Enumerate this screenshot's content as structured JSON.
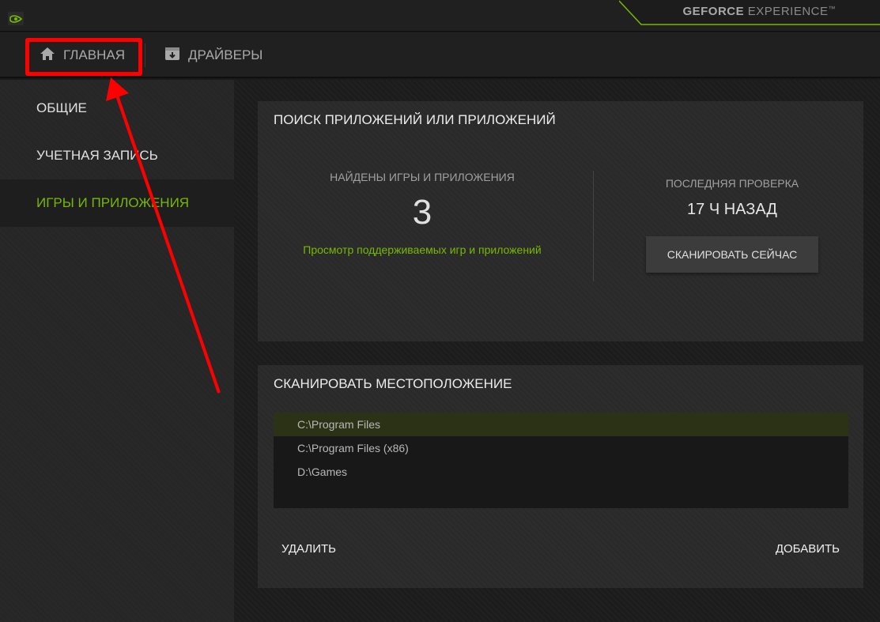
{
  "brand": {
    "bold": "GEFORCE",
    "light": "EXPERIENCE",
    "tm": "™"
  },
  "nav": {
    "home_label": "ГЛАВНАЯ",
    "drivers_label": "ДРАЙВЕРЫ"
  },
  "sidebar": {
    "items": [
      {
        "label": "ОБЩИЕ"
      },
      {
        "label": "УЧЕТНАЯ ЗАПИСЬ"
      },
      {
        "label": "ИГРЫ И ПРИЛОЖЕНИЯ"
      }
    ],
    "active_index": 2
  },
  "search_panel": {
    "title": "ПОИСК ПРИЛОЖЕНИЙ ИЛИ ПРИЛОЖЕНИЙ",
    "found_label": "НАЙДЕНЫ ИГРЫ И ПРИЛОЖЕНИЯ",
    "found_count": "3",
    "supported_link": "Просмотр поддерживаемых игр и приложений",
    "last_check_label": "ПОСЛЕДНЯЯ ПРОВЕРКА",
    "last_check_value": "17 Ч НАЗАД",
    "scan_button": "СКАНИРОВАТЬ СЕЙЧАС"
  },
  "location_panel": {
    "title": "СКАНИРОВАТЬ МЕСТОПОЛОЖЕНИЕ",
    "locations": [
      {
        "path": "C:\\Program Files"
      },
      {
        "path": "C:\\Program Files (x86)"
      },
      {
        "path": "D:\\Games"
      }
    ],
    "selected_index": 0,
    "delete_label": "УДАЛИТЬ",
    "add_label": "ДОБАВИТЬ"
  },
  "colors": {
    "accent": "#76b900",
    "annotation": "#ff0000"
  },
  "icons": {
    "home": "home-icon",
    "drivers": "drivers-icon",
    "logo": "nvidia-logo-icon"
  }
}
